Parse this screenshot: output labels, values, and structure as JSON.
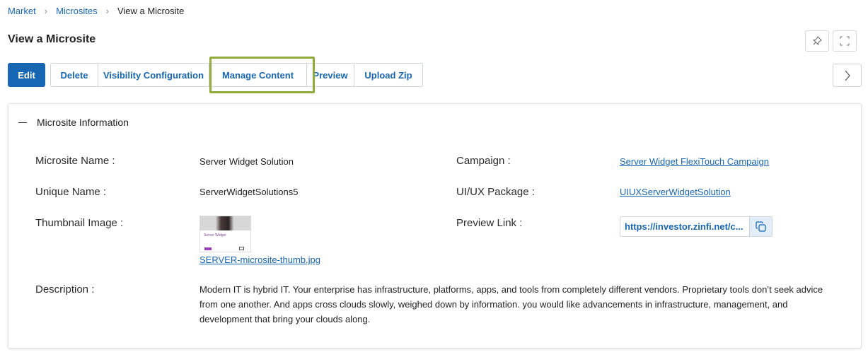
{
  "breadcrumb": {
    "items": [
      "Market",
      "Microsites"
    ],
    "current": "View a Microsite"
  },
  "page_title": "View a Microsite",
  "toolbar": {
    "edit": "Edit",
    "delete": "Delete",
    "visibility": "Visibility Configuration",
    "manage_content": "Manage Content",
    "preview": "Preview",
    "upload_zip": "Upload Zip"
  },
  "icons": {
    "pin": "pin-icon",
    "expand": "expand-icon",
    "next": "chevron-right-icon",
    "collapse": "minus-icon",
    "copy": "copy-icon"
  },
  "colors": {
    "primary": "#1766b4",
    "highlight": "#8fac3b",
    "copy_bg": "#e2edf8"
  },
  "section": {
    "title": "Microsite Information",
    "fields": {
      "name_label": "Microsite Name :",
      "name_value": "Server Widget Solution",
      "campaign_label": "Campaign :",
      "campaign_value": "Server Widget FlexiTouch Campaign",
      "unique_label": "Unique Name :",
      "unique_value": "ServerWidgetSolutions5",
      "package_label": "UI/UX Package :",
      "package_value": "UIUXServerWidgetSolution",
      "thumb_label": "Thumbnail Image :",
      "thumb_file": "SERVER-microsite-thumb.jpg",
      "thumb_caption": "Server Widget",
      "preview_label": "Preview Link :",
      "preview_value": "https://investor.zinfi.net/c...",
      "description_label": "Description :",
      "description_value": "Modern IT is hybrid IT. Your enterprise has infrastructure, platforms, apps, and tools from completely different vendors. Proprietary tools don’t seek advice from one another. And apps cross clouds slowly, weighed down by information. you would like advancements in infrastructure, management, and development that bring your clouds along."
    }
  }
}
